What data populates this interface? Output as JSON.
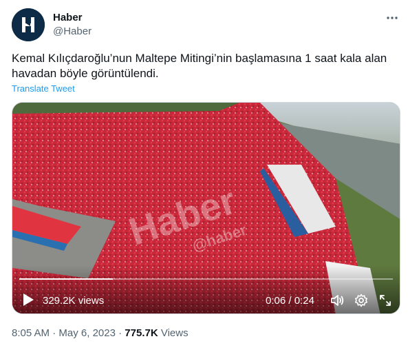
{
  "author": {
    "display_name": "Haber",
    "handle": "@Haber",
    "avatar_letter": "H",
    "avatar_color": "#0d2a46"
  },
  "tweet": {
    "text": "Kemal Kılıçdaroğlu’nun Maltepe Mitingi’nin başlamasına 1 saat kala alan havadan böyle görüntülendi.",
    "translate_label": "Translate Tweet"
  },
  "video": {
    "watermark_main": "Haber",
    "watermark_sub": "@haber",
    "views": "329.2K views",
    "current_time": "0:06",
    "time_separator": "/",
    "duration": "0:24",
    "progress_fraction": 0.25
  },
  "footer": {
    "time": "8:05 AM",
    "separator1": "·",
    "date": "May 6, 2023",
    "separator2": "·",
    "view_count": "775.7K",
    "views_label": "Views"
  },
  "icons": {
    "more": "more-icon",
    "play": "play-icon",
    "volume": "volume-icon",
    "settings": "gear-icon",
    "fullscreen": "fullscreen-icon"
  },
  "colors": {
    "link": "#1d9bf0",
    "secondary_text": "#536471",
    "crowd_red": "#c8283a"
  }
}
